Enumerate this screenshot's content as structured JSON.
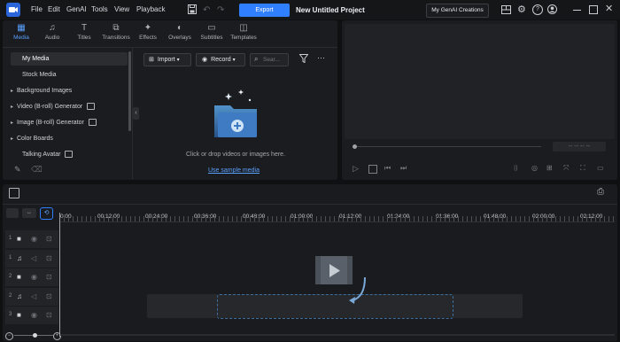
{
  "app": {
    "logo": "app-logo-icon"
  },
  "menu": [
    "File",
    "Edit",
    "GenAI",
    "Tools",
    "View",
    "Playback"
  ],
  "toolbar": {
    "export": "Export",
    "project_title": "New Untitled Project",
    "genai_creations": "My GenAI Creations"
  },
  "tabs": [
    {
      "label": "Media",
      "icon": "media-icon"
    },
    {
      "label": "Audio",
      "icon": "music-icon"
    },
    {
      "label": "Titles",
      "icon": "title-icon"
    },
    {
      "label": "Transitions",
      "icon": "transition-icon"
    },
    {
      "label": "Effects",
      "icon": "effects-icon"
    },
    {
      "label": "Overlays",
      "icon": "overlay-icon"
    },
    {
      "label": "Subtitles",
      "icon": "subtitle-icon"
    },
    {
      "label": "Templates",
      "icon": "template-icon"
    }
  ],
  "sidebar": {
    "items": [
      {
        "label": "My Media",
        "selected": true,
        "expandable": false
      },
      {
        "label": "Stock Media",
        "selected": false,
        "expandable": false
      },
      {
        "label": "Background Images",
        "selected": false,
        "expandable": true
      },
      {
        "label": "Video (B-roll) Generator",
        "selected": false,
        "expandable": true
      },
      {
        "label": "Image (B-roll) Generator",
        "selected": false,
        "expandable": true
      },
      {
        "label": "Color Boards",
        "selected": false,
        "expandable": true
      },
      {
        "label": "Talking Avatar",
        "selected": false,
        "expandable": false
      }
    ]
  },
  "media": {
    "import_label": "Import",
    "record_label": "Record",
    "search_placeholder": "Sear...",
    "empty_text": "Click or drop videos or images here.",
    "sample_link": "Use sample media"
  },
  "preview": {
    "timecode": "-- -- -- --"
  },
  "timeline": {
    "ruler": [
      "0:00",
      "00:12:00",
      "00:24:00",
      "00:36:00",
      "00:48:00",
      "01:00:00",
      "01:12:00",
      "01:24:00",
      "01:36:00",
      "01:48:00",
      "02:00:00",
      "02:12:00"
    ],
    "tracks": [
      {
        "num": "1",
        "type": "video"
      },
      {
        "num": "1",
        "type": "audio"
      },
      {
        "num": "2",
        "type": "video"
      },
      {
        "num": "2",
        "type": "audio"
      },
      {
        "num": "3",
        "type": "video"
      }
    ]
  },
  "colors": {
    "accent": "#2f7fff",
    "tab_active": "#5aa0ff",
    "link": "#5aa0ff"
  }
}
